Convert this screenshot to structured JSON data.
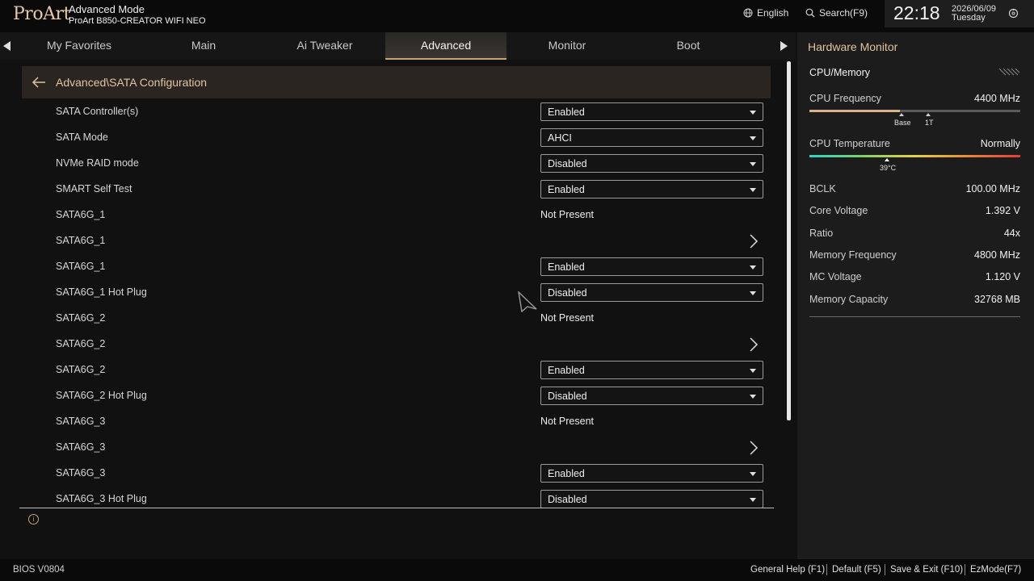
{
  "header": {
    "logo": "ProArt",
    "mode": "Advanced Mode",
    "model": "ProArt B850-CREATOR WIFI NEO",
    "language": "English",
    "search": "Search(F9)",
    "time": "22:18",
    "date": "2026/06/09",
    "weekday": "Tuesday"
  },
  "tabs": [
    "My Favorites",
    "Main",
    "Ai Tweaker",
    "Advanced",
    "Monitor",
    "Boot"
  ],
  "active_tab": "Advanced",
  "breadcrumb": "Advanced\\SATA Configuration",
  "settings": [
    {
      "label": "SATA Controller(s)",
      "type": "select",
      "value": "Enabled"
    },
    {
      "label": "SATA Mode",
      "type": "select",
      "value": "AHCI"
    },
    {
      "label": "NVMe RAID mode",
      "type": "select",
      "value": "Disabled"
    },
    {
      "label": "SMART Self Test",
      "type": "select",
      "value": "Enabled"
    },
    {
      "label": "SATA6G_1",
      "type": "text",
      "value": "Not Present"
    },
    {
      "label": "SATA6G_1",
      "type": "submenu",
      "value": ""
    },
    {
      "label": "SATA6G_1",
      "type": "select",
      "value": "Enabled"
    },
    {
      "label": "SATA6G_1 Hot Plug",
      "type": "select",
      "value": "Disabled"
    },
    {
      "label": "SATA6G_2",
      "type": "text",
      "value": "Not Present"
    },
    {
      "label": "SATA6G_2",
      "type": "submenu",
      "value": ""
    },
    {
      "label": "SATA6G_2",
      "type": "select",
      "value": "Enabled"
    },
    {
      "label": "SATA6G_2 Hot Plug",
      "type": "select",
      "value": "Disabled"
    },
    {
      "label": "SATA6G_3",
      "type": "text",
      "value": "Not Present"
    },
    {
      "label": "SATA6G_3",
      "type": "submenu",
      "value": ""
    },
    {
      "label": "SATA6G_3",
      "type": "select",
      "value": "Enabled"
    },
    {
      "label": "SATA6G_3 Hot Plug",
      "type": "select",
      "value": "Disabled"
    }
  ],
  "hardware_monitor": {
    "title": "Hardware Monitor",
    "section": "CPU/Memory",
    "cpu_frequency_label": "CPU Frequency",
    "cpu_frequency": "4400 MHz",
    "cpu_frequency_fraction": 0.43,
    "base_label": "Base",
    "turbo_label": "1T",
    "cpu_temperature_label": "CPU Temperature",
    "cpu_temperature_status": "Normally",
    "cpu_temperature": "39°C",
    "items": [
      {
        "label": "BCLK",
        "value": "100.00 MHz"
      },
      {
        "label": "Core Voltage",
        "value": "1.392 V"
      },
      {
        "label": "Ratio",
        "value": "44x"
      },
      {
        "label": "Memory Frequency",
        "value": "4800 MHz"
      },
      {
        "label": "MC Voltage",
        "value": "1.120 V"
      },
      {
        "label": "Memory Capacity",
        "value": "32768 MB"
      }
    ]
  },
  "footer": {
    "bios_version": "BIOS V0804",
    "hints": [
      "General Help (F1)",
      "Default (F5)",
      "Save & Exit (F10)",
      "EzMode(F7)"
    ]
  },
  "colors": {
    "accent": "#c8a27a",
    "background": "#111111",
    "panel": "#1c1c1c"
  }
}
